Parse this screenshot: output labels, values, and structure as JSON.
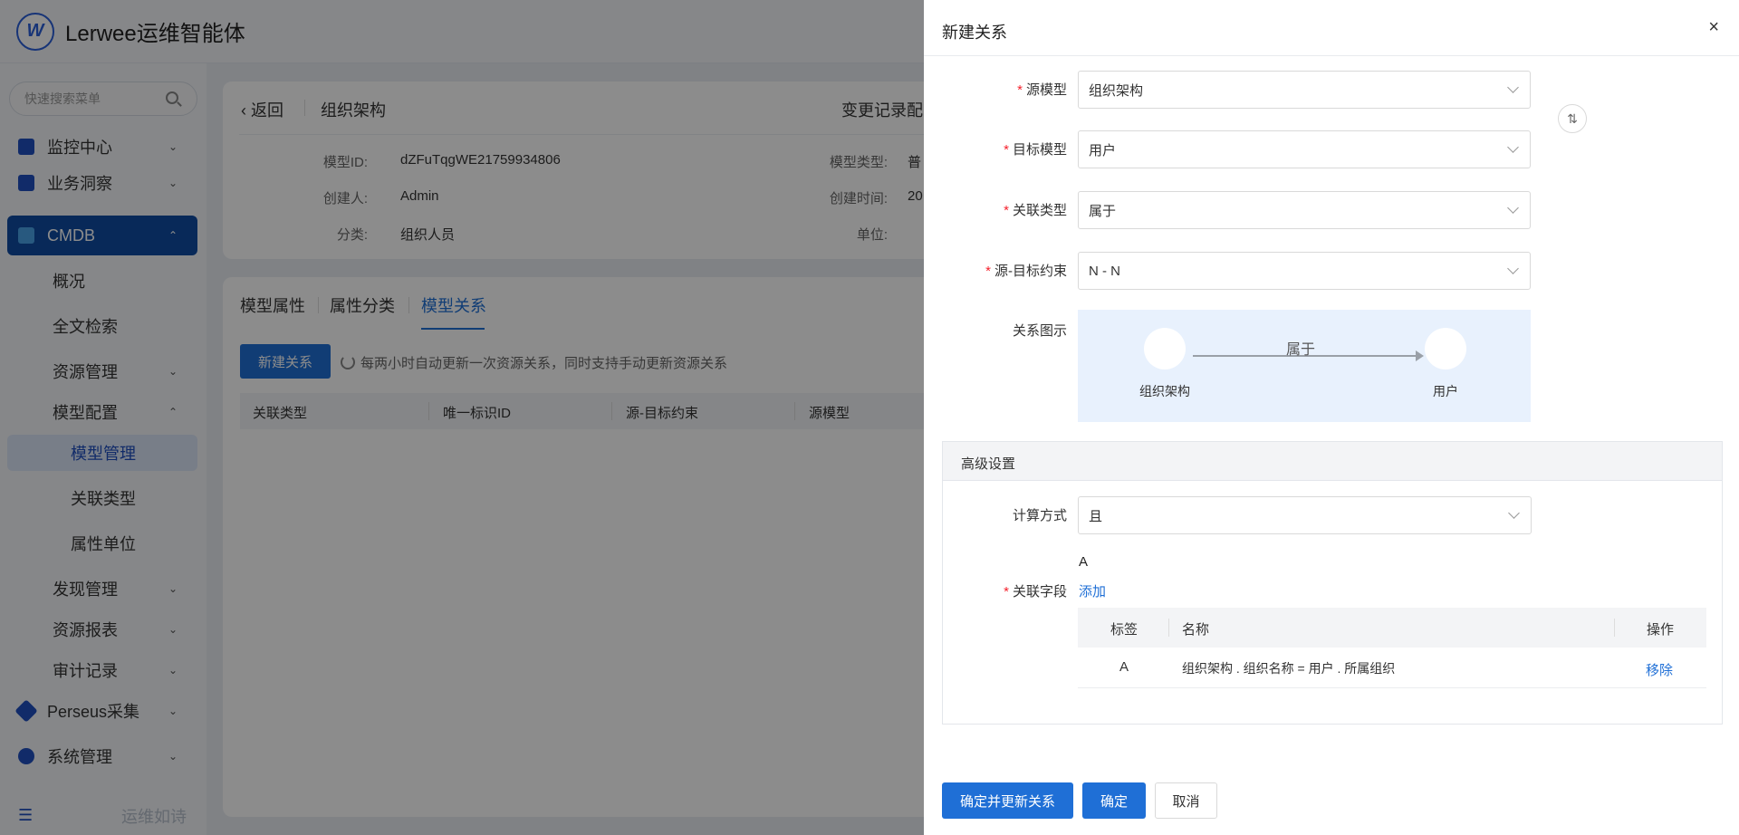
{
  "app": {
    "brand": "Lerwee运维智能体"
  },
  "sidebar": {
    "search_placeholder": "快速搜索菜单",
    "items": [
      {
        "label": "监控中心"
      },
      {
        "label": "业务洞察"
      },
      {
        "label": "CMDB"
      },
      {
        "label": "概况"
      },
      {
        "label": "全文检索"
      },
      {
        "label": "资源管理"
      },
      {
        "label": "模型配置"
      },
      {
        "label": "模型管理"
      },
      {
        "label": "关联类型"
      },
      {
        "label": "属性单位"
      },
      {
        "label": "发现管理"
      },
      {
        "label": "资源报表"
      },
      {
        "label": "审计记录"
      },
      {
        "label": "Perseus采集"
      },
      {
        "label": "系统管理"
      }
    ],
    "footer": "运维如诗"
  },
  "page": {
    "back": "返回",
    "title": "组织架构",
    "right_action": "变更记录配",
    "info": {
      "model_id_label": "模型ID:",
      "model_id": "dZFuTqgWE21759934806",
      "creator_label": "创建人:",
      "creator": "Admin",
      "category_label": "分类:",
      "category": "组织人员",
      "model_type_label": "模型类型:",
      "model_type": "普",
      "created_time_label": "创建时间:",
      "created_time": "20",
      "unit_label": "单位:"
    },
    "tabs": [
      "模型属性",
      "属性分类",
      "模型关系"
    ],
    "new_relation_btn": "新建关系",
    "refresh_hint": "每两小时自动更新一次资源关系，同时支持手动更新资源关系",
    "columns": [
      "关联类型",
      "唯一标识ID",
      "源-目标约束",
      "源模型"
    ]
  },
  "drawer": {
    "title": "新建关系",
    "close": "×",
    "source_model_label": "源模型",
    "source_model": "组织架构",
    "target_model_label": "目标模型",
    "target_model": "用户",
    "relation_type_label": "关联类型",
    "relation_type": "属于",
    "constraint_label": "源-目标约束",
    "constraint": "N - N",
    "diagram_label": "关系图示",
    "diagram": {
      "source": "组织架构",
      "relation": "属于",
      "target": "用户"
    },
    "advanced_title": "高级设置",
    "calc_label": "计算方式",
    "calc_value": "且",
    "expr": "A",
    "fields_label": "关联字段",
    "add_link": "添加",
    "fields_table": {
      "headers": [
        "标签",
        "名称",
        "操作"
      ],
      "rows": [
        {
          "tag": "A",
          "name": "组织架构 . 组织名称 = 用户 . 所属组织",
          "action": "移除"
        }
      ]
    },
    "buttons": {
      "confirm_update": "确定并更新关系",
      "confirm": "确定",
      "cancel": "取消"
    }
  }
}
